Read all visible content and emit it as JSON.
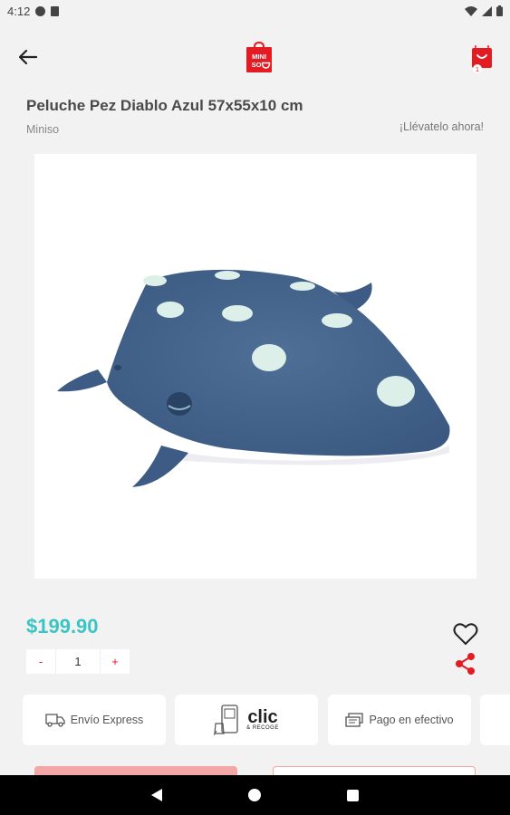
{
  "status_bar": {
    "time": "4:12",
    "icons": [
      "data-saver-icon",
      "sd-card-icon",
      "wifi-icon",
      "signal-icon",
      "battery-icon"
    ]
  },
  "header": {
    "logo_text_top": "MINI",
    "logo_text_bottom": "SO",
    "cart_count": "1",
    "brand_color": "#e31b23"
  },
  "product": {
    "title": "Peluche Pez Diablo Azul 57x55x10 cm",
    "brand": "Miniso",
    "tagline": "¡Llévatelo ahora!",
    "image_alt": "Peluche pez diablo azul con puntos blancos",
    "price": "$199.90",
    "price_color": "#3cc4c4"
  },
  "quantity": {
    "minus": "-",
    "value": "1",
    "plus": "+"
  },
  "features": [
    {
      "label": "Envío Express",
      "icon": "delivery-truck-icon"
    },
    {
      "label": "clic",
      "sublabel": "& RECOGE",
      "icon": "phone-bag-icon"
    },
    {
      "label": "Pago en efectivo",
      "icon": "cash-icon"
    }
  ]
}
